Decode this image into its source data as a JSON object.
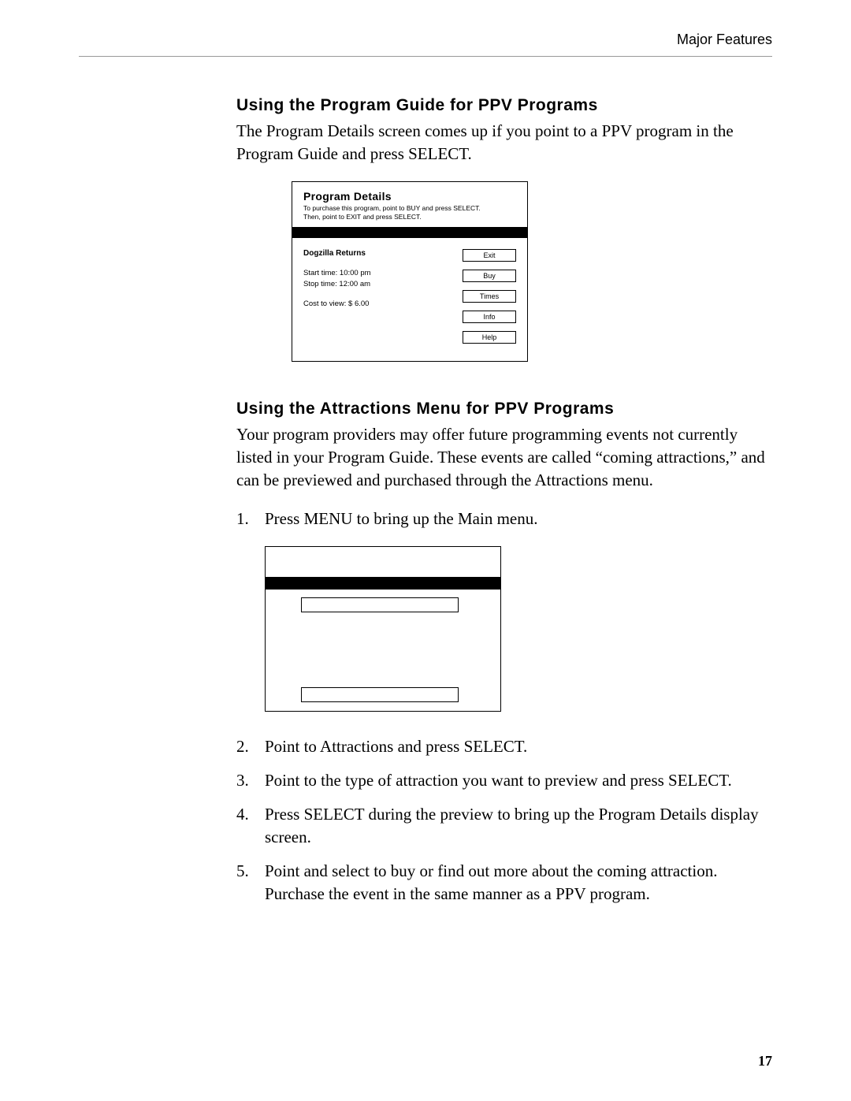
{
  "header": {
    "section_title": "Major Features"
  },
  "section1": {
    "heading": "Using the Program Guide for PPV Programs",
    "para": "The Program Details screen comes up if you point to a PPV program in the Program Guide and press SELECT."
  },
  "program_details": {
    "title": "Program Details",
    "sub1": "To purchase this program, point to BUY and press SELECT.",
    "sub2": "Then, point to EXIT and press SELECT.",
    "program_name": "Dogzilla Returns",
    "start": "Start time: 10:00 pm",
    "stop": "Stop time: 12:00 am",
    "cost": "Cost to view: $ 6.00",
    "buttons": {
      "exit": "Exit",
      "buy": "Buy",
      "times": "Times",
      "info": "Info",
      "help": "Help"
    }
  },
  "section2": {
    "heading": "Using the Attractions Menu for PPV Programs",
    "para": "Your program providers may offer future programming events not currently listed in your Program Guide. These events are called “coming attractions,” and can be previewed and purchased through the Attractions menu."
  },
  "steps": {
    "s1": "Press MENU to bring up the Main menu.",
    "s2": "Point to Attractions and press SELECT.",
    "s3": "Point to the type of attraction you want to preview and press SELECT.",
    "s4": "Press SELECT during the preview to bring up the Program Details display screen.",
    "s5": "Point and select to buy or find out more about the coming attraction. Purchase the event in the same manner as a PPV program."
  },
  "page_number": "17"
}
